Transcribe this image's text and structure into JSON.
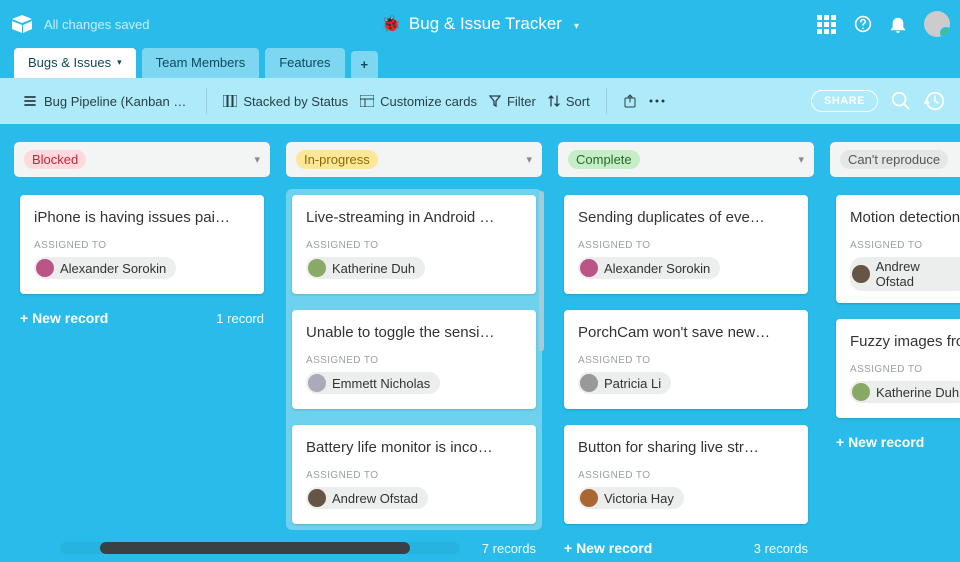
{
  "header": {
    "save_status": "All changes saved",
    "title": "Bug & Issue Tracker"
  },
  "tabs": {
    "items": [
      {
        "label": "Bugs & Issues",
        "active": true,
        "has_caret": true
      },
      {
        "label": "Team Members"
      },
      {
        "label": "Features"
      }
    ]
  },
  "toolbar": {
    "view_name": "Bug Pipeline (Kanban …",
    "stacked_by": "Stacked by Status",
    "customize": "Customize cards",
    "filter": "Filter",
    "sort": "Sort",
    "share": "SHARE"
  },
  "columns": [
    {
      "name": "Blocked",
      "pill_bg": "#ffd9dc",
      "pill_fg": "#c0283b",
      "active": false,
      "cards": [
        {
          "title": "iPhone is having issues pai…",
          "assignee": "Alexander Sorokin",
          "av": "#b58"
        }
      ],
      "footer_count": "1 record"
    },
    {
      "name": "In-progress",
      "pill_bg": "#ffe79a",
      "pill_fg": "#8a6b00",
      "active": true,
      "cards": [
        {
          "title": "Live-streaming in Android …",
          "assignee": "Katherine Duh",
          "av": "#8a6"
        },
        {
          "title": "Unable to toggle the sensi…",
          "assignee": "Emmett Nicholas",
          "av": "#aab"
        },
        {
          "title": "Battery life monitor is inco…",
          "assignee": "Andrew Ofstad",
          "av": "#654"
        }
      ],
      "footer_count": "7 records"
    },
    {
      "name": "Complete",
      "pill_bg": "#c6eec6",
      "pill_fg": "#256b28",
      "active": false,
      "cards": [
        {
          "title": "Sending duplicates of eve…",
          "assignee": "Alexander Sorokin",
          "av": "#b58"
        },
        {
          "title": "PorchCam won't save new…",
          "assignee": "Patricia Li",
          "av": "#999"
        },
        {
          "title": "Button for sharing live str…",
          "assignee": "Victoria Hay",
          "av": "#a63"
        }
      ],
      "footer_count": "3 records"
    },
    {
      "name": "Can't reproduce",
      "pill_bg": "#e6e6e6",
      "pill_fg": "#555",
      "active": false,
      "cards": [
        {
          "title": "Motion detection",
          "assignee": "Andrew Ofstad",
          "av": "#654"
        },
        {
          "title": "Fuzzy images fro",
          "assignee": "Katherine Duh",
          "av": "#8a6"
        }
      ],
      "footer_count": ""
    }
  ],
  "labels": {
    "assigned_to": "ASSIGNED TO",
    "new_record": "+ New record"
  }
}
